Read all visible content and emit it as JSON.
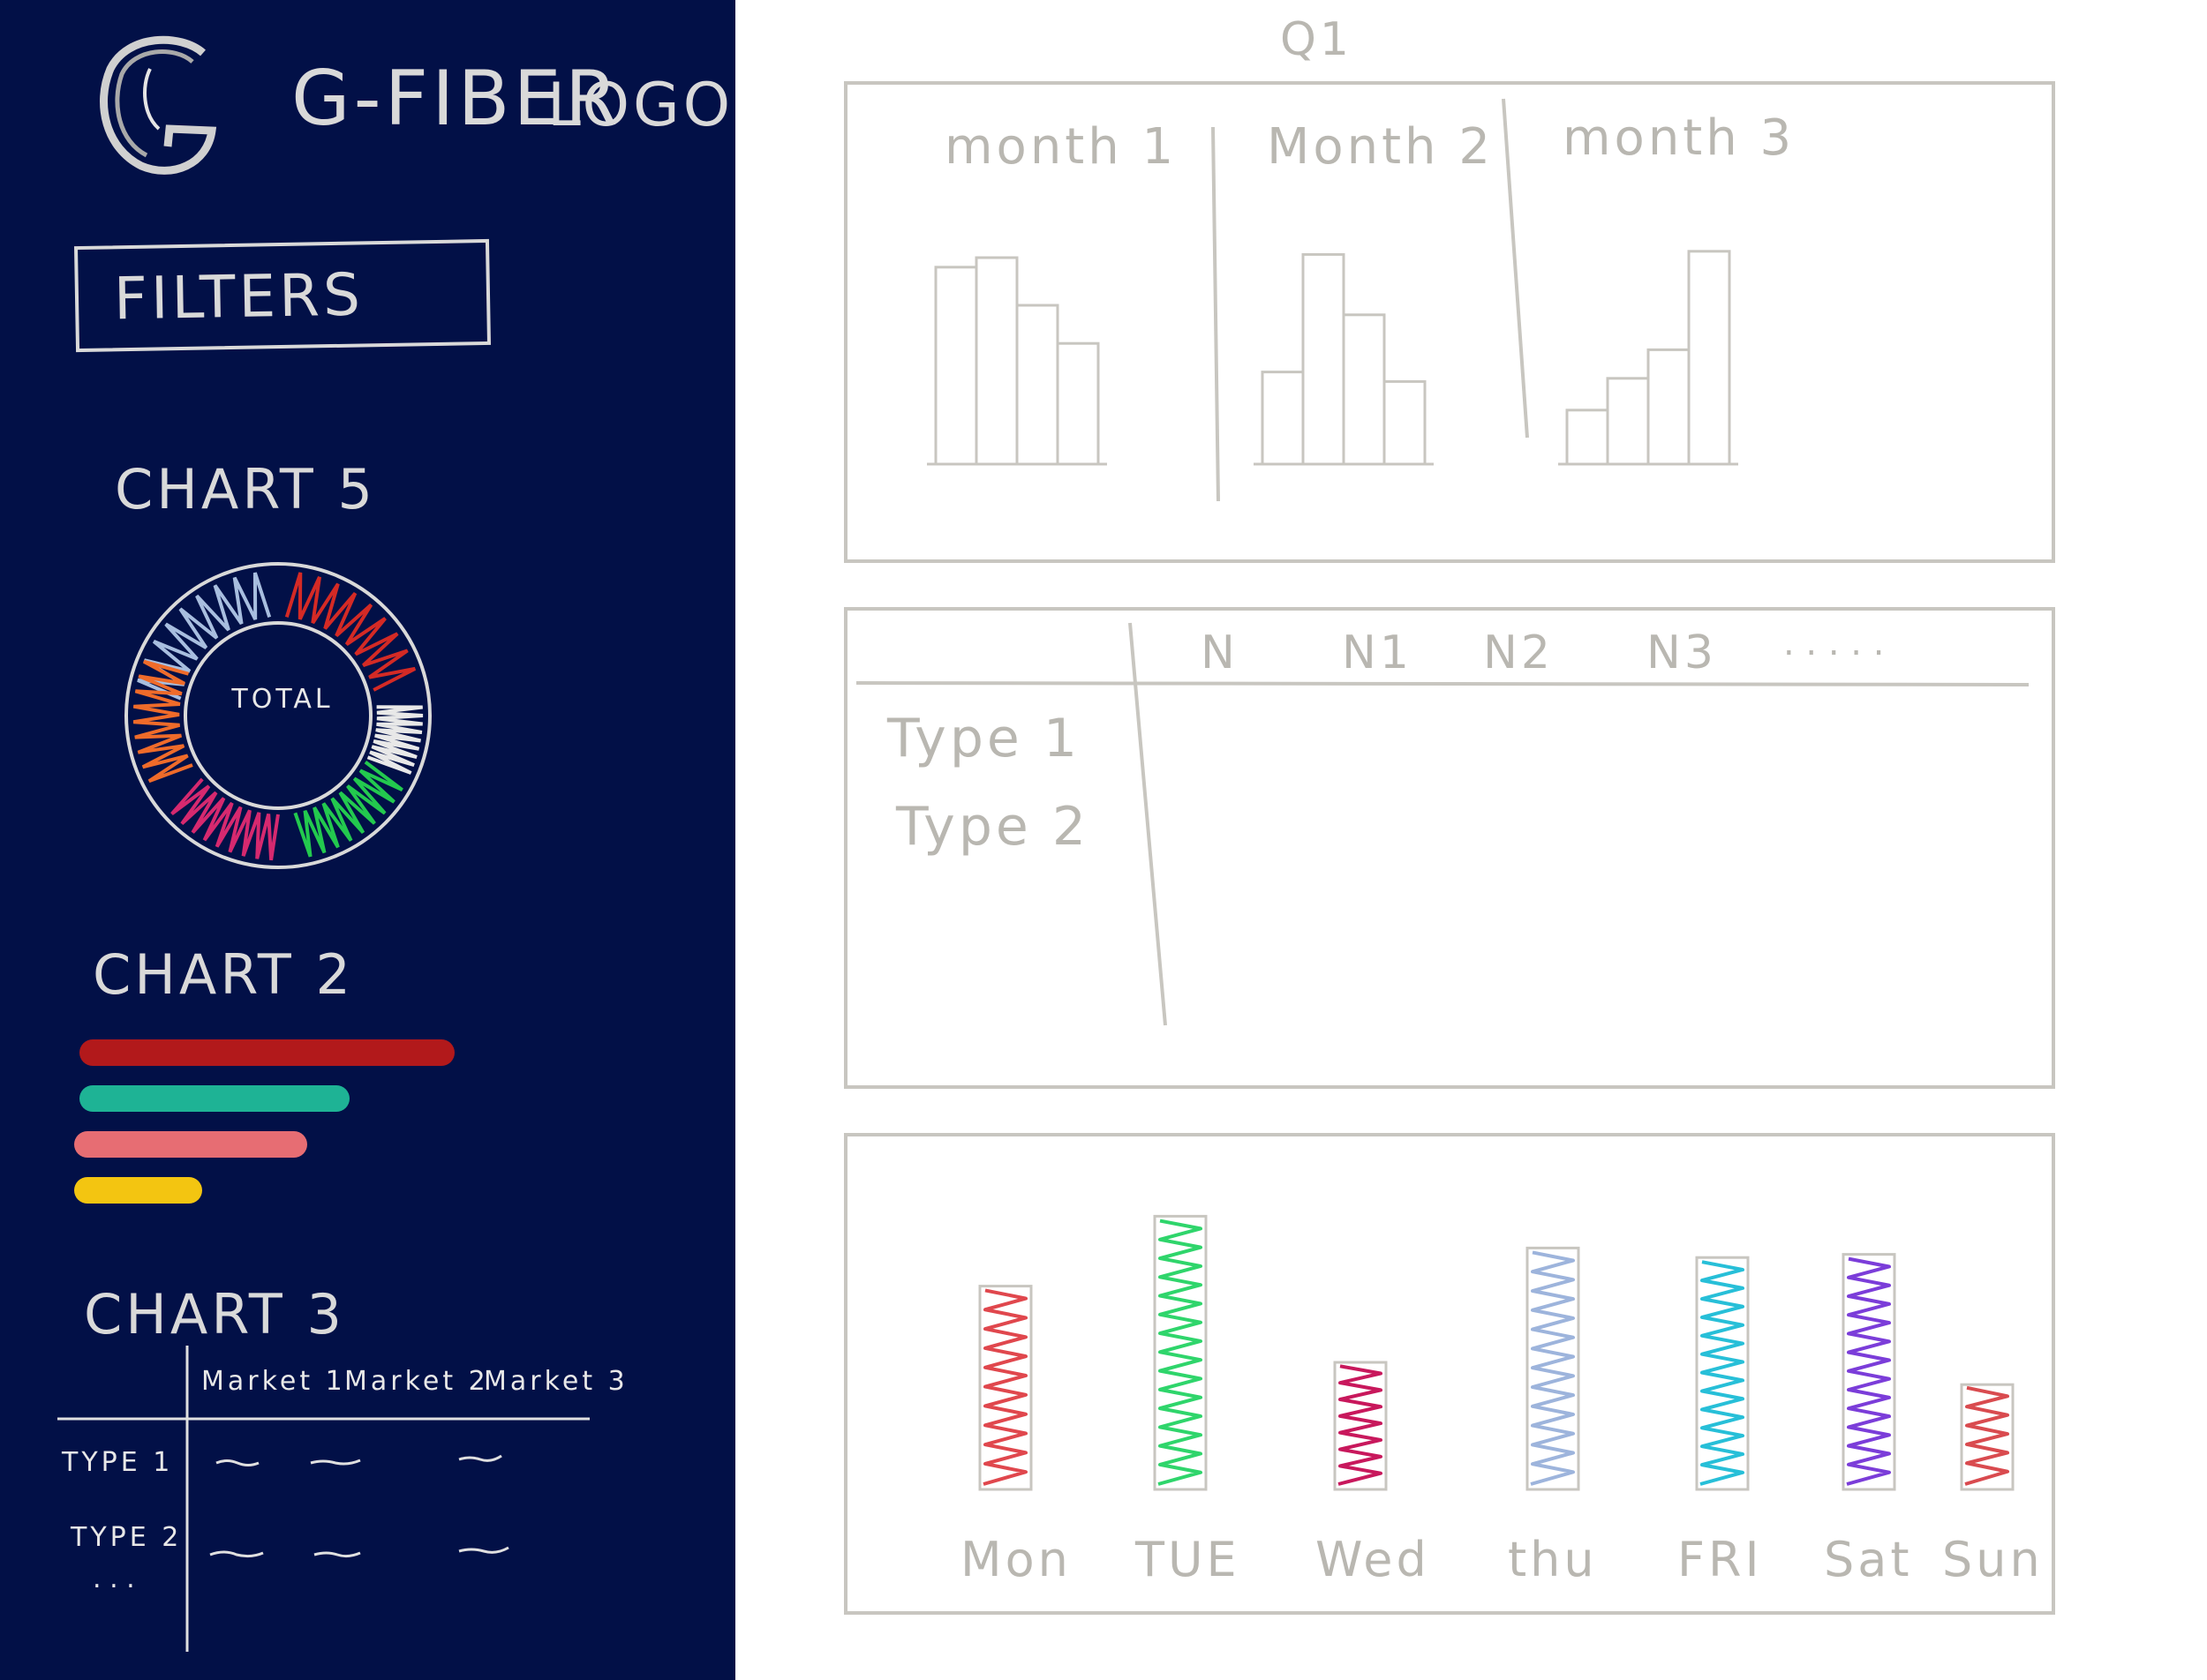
{
  "sidebar": {
    "logo_text": "G-FIBER",
    "logo_word": "LOGO",
    "filters_label": "FILTERS",
    "chart5": {
      "title": "CHART 5",
      "center_label": "TOTAL",
      "segment_colors": [
        "#a8bedf",
        "#d42a25",
        "#e8e8e8",
        "#23c94e",
        "#d6296f",
        "#ef6b2a"
      ]
    },
    "chart2": {
      "title": "CHART 2",
      "bars": [
        {
          "color": "#b2191b",
          "fraction": 1.0
        },
        {
          "color": "#1eb395",
          "fraction": 0.72
        },
        {
          "color": "#e76d73",
          "fraction": 0.62
        },
        {
          "color": "#f3c511",
          "fraction": 0.34
        }
      ]
    },
    "chart3": {
      "title": "CHART 3",
      "columns": [
        "Market 1",
        "Market 2",
        "Market 3"
      ],
      "rows": [
        "TYPE 1",
        "TYPE 2"
      ],
      "more": ". . ."
    }
  },
  "main": {
    "q_label": "Q1",
    "panel1": {
      "months": [
        "month 1",
        "Month 2",
        "month 3"
      ],
      "bar_fractions": [
        [
          0.62,
          0.65,
          0.5,
          0.38
        ],
        [
          0.29,
          0.66,
          0.47,
          0.26
        ],
        [
          0.17,
          0.27,
          0.36,
          0.67
        ]
      ]
    },
    "panel2": {
      "columns": [
        "N",
        "N1",
        "N2",
        "N3",
        ". . . . ."
      ],
      "rows": [
        "Type 1",
        "Type 2"
      ]
    },
    "panel3": {
      "bars": [
        {
          "label": "Mon",
          "color": "#e0474d",
          "fraction": 0.64
        },
        {
          "label": "TUE",
          "color": "#2fd56b",
          "fraction": 0.86
        },
        {
          "label": "Wed",
          "color": "#c8185c",
          "fraction": 0.4
        },
        {
          "label": "thu",
          "color": "#9db4dc",
          "fraction": 0.76
        },
        {
          "label": "FRI",
          "color": "#27bfd8",
          "fraction": 0.73
        },
        {
          "label": "Sat",
          "color": "#7b3dd9",
          "fraction": 0.74
        },
        {
          "label": "Sun",
          "color": "#d94b4f",
          "fraction": 0.33
        }
      ]
    }
  }
}
